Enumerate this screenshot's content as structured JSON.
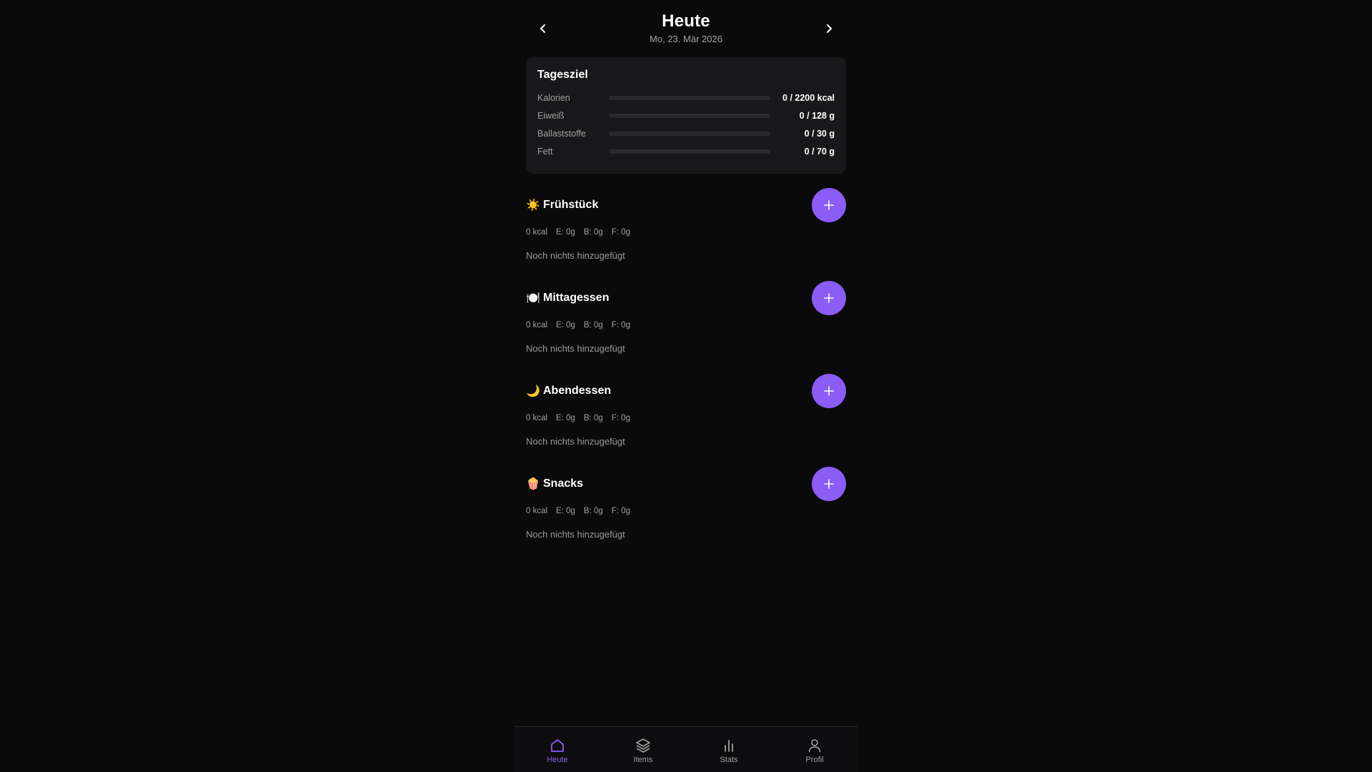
{
  "header": {
    "title": "Heute",
    "date": "Mo, 23. Mär 2026",
    "prev_icon": "chevron-left-icon",
    "next_icon": "chevron-right-icon"
  },
  "goals": {
    "title": "Tagesziel",
    "rows": [
      {
        "label": "Kalorien",
        "value": "0 / 2200 kcal",
        "progress": 0
      },
      {
        "label": "Eiweiß",
        "value": "0 / 128 g",
        "progress": 0
      },
      {
        "label": "Ballaststoffe",
        "value": "0 / 30 g",
        "progress": 0
      },
      {
        "label": "Fett",
        "value": "0 / 70 g",
        "progress": 0
      }
    ]
  },
  "meals": [
    {
      "emoji": "☀️",
      "name": "Frühstück",
      "kcal": "0 kcal",
      "e": "E: 0g",
      "b": "B: 0g",
      "f": "F: 0g",
      "empty": "Noch nichts hinzugefügt"
    },
    {
      "emoji": "🍽️",
      "name": "Mittagessen",
      "kcal": "0 kcal",
      "e": "E: 0g",
      "b": "B: 0g",
      "f": "F: 0g",
      "empty": "Noch nichts hinzugefügt"
    },
    {
      "emoji": "🌙",
      "name": "Abendessen",
      "kcal": "0 kcal",
      "e": "E: 0g",
      "b": "B: 0g",
      "f": "F: 0g",
      "empty": "Noch nichts hinzugefügt"
    },
    {
      "emoji": "🍿",
      "name": "Snacks",
      "kcal": "0 kcal",
      "e": "E: 0g",
      "b": "B: 0g",
      "f": "F: 0g",
      "empty": "Noch nichts hinzugefügt"
    }
  ],
  "add_icon": "plus-icon",
  "bottom_nav": {
    "items": [
      {
        "label": "Heute",
        "icon": "home-icon",
        "active": true
      },
      {
        "label": "Items",
        "icon": "layers-icon",
        "active": false
      },
      {
        "label": "Stats",
        "icon": "bar-chart-icon",
        "active": false
      },
      {
        "label": "Profil",
        "icon": "user-icon",
        "active": false
      }
    ]
  },
  "colors": {
    "accent": "#8b5cf6",
    "background": "#0a0a0b",
    "card": "#18181a",
    "muted_text": "#a0a0a0"
  }
}
